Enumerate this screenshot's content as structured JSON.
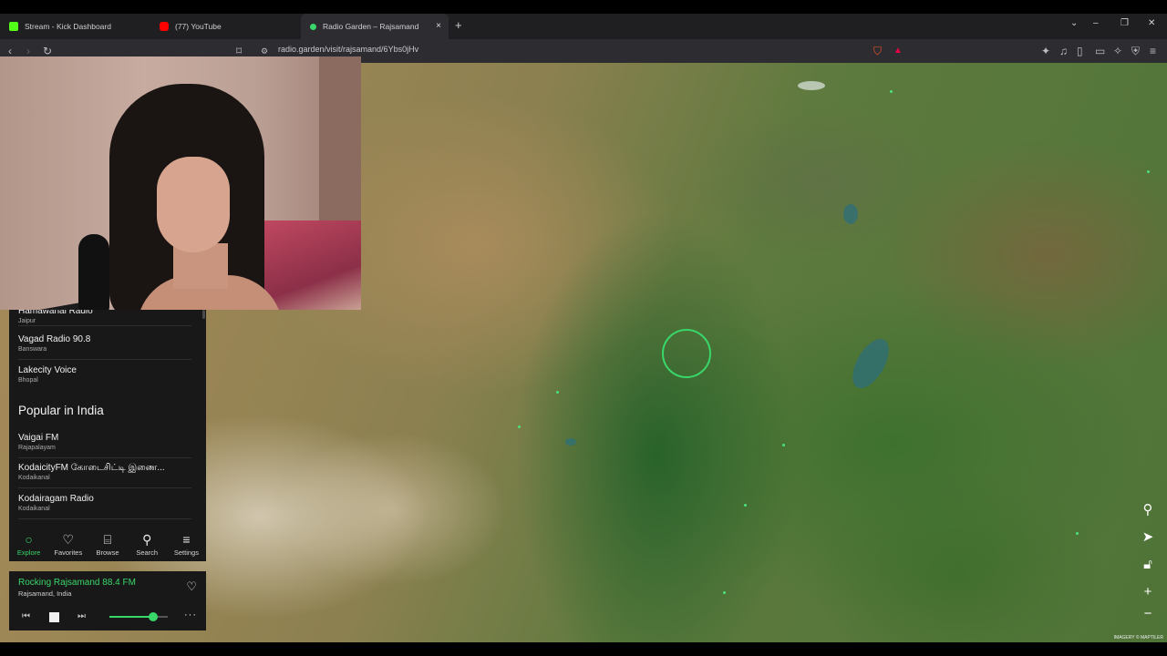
{
  "browser": {
    "tabs": [
      {
        "title": "Stream - Kick Dashboard",
        "favicon": "kick-icon",
        "color": "#53fc18"
      },
      {
        "title": "(77) YouTube",
        "favicon": "youtube-icon",
        "color": "#ff0000"
      },
      {
        "title": "Radio Garden – Rajsamand",
        "favicon": "radio-garden-icon",
        "color": "#39d66a",
        "active": true
      }
    ],
    "new_tab": "+",
    "tab_close": "×",
    "url": "radio.garden/visit/rajsamand/6Ybs0jHv"
  },
  "panel": {
    "stations": [
      {
        "name": "Hamawanai Radio",
        "place": "Jaipur"
      },
      {
        "name": "Vagad Radio 90.8",
        "place": "Banswara"
      },
      {
        "name": "Lakecity Voice",
        "place": "Bhopal"
      }
    ],
    "section_title": "Popular in India",
    "popular": [
      {
        "name": "Vaigai FM",
        "place": "Rajapalayam"
      },
      {
        "name": "KodaicityFM கோடைசிட்டி இணை...",
        "place": "Kodaikanal"
      },
      {
        "name": "Kodairagam Radio",
        "place": "Kodaikanal"
      }
    ],
    "nav": [
      {
        "label": "Explore",
        "icon": "explore-icon",
        "active": true
      },
      {
        "label": "Favorites",
        "icon": "heart-icon"
      },
      {
        "label": "Browse",
        "icon": "map-icon"
      },
      {
        "label": "Search",
        "icon": "search-icon"
      },
      {
        "label": "Settings",
        "icon": "menu-icon"
      }
    ]
  },
  "player": {
    "station": "Rocking Rajsamand 88.4 FM",
    "location": "Rajsamand, India",
    "volume": 0.75
  },
  "map": {
    "attribution": "IMAGERY © MAPTILER",
    "accent": "#39d66a"
  }
}
